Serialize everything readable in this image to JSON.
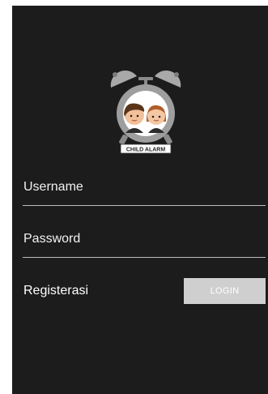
{
  "logo": {
    "badge_text": "CHILD ALARM"
  },
  "login_form": {
    "username_placeholder": "Username",
    "username_value": "",
    "password_placeholder": "Password",
    "password_value": "",
    "register_label": "Registerasi",
    "login_label": "LOGIN"
  },
  "colors": {
    "background": "#1c1c1c",
    "field_underline": "#bdbdbd",
    "login_button": "#cfcfcf",
    "text": "#ffffff"
  }
}
